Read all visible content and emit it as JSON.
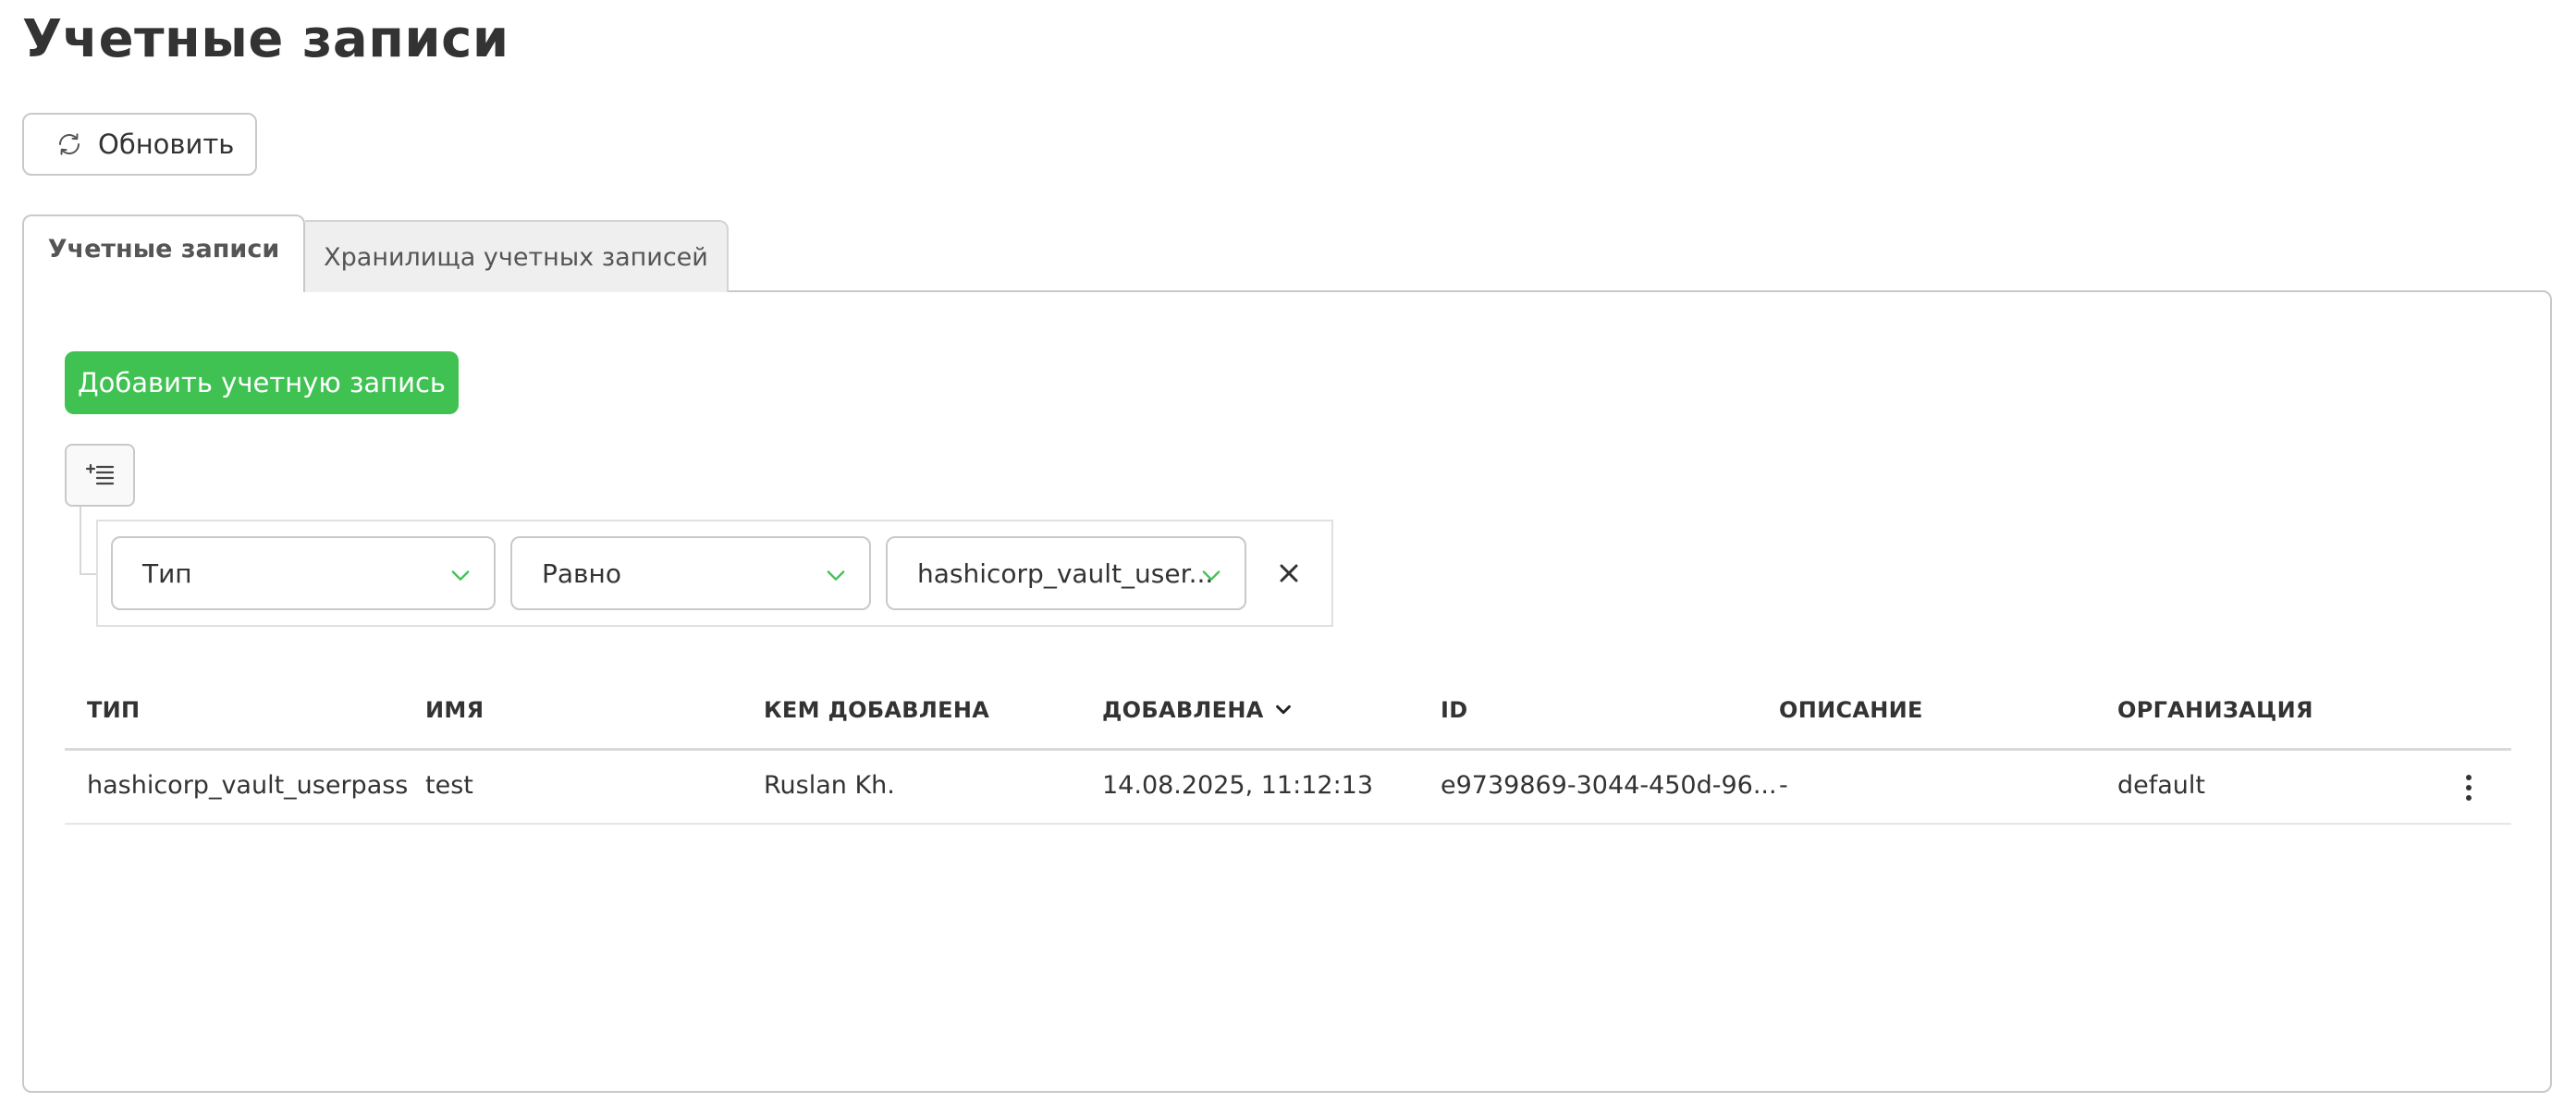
{
  "page": {
    "title": "Учетные записи"
  },
  "toolbar": {
    "refresh_label": "Обновить"
  },
  "tabs": [
    {
      "label": "Учетные записи",
      "active": true
    },
    {
      "label": "Хранилища учетных записей",
      "active": false
    }
  ],
  "actions": {
    "add_label": "Добавить учетную запись",
    "add_color": "#3fc252"
  },
  "filter": {
    "field": "Тип",
    "operator": "Равно",
    "value": "hashicorp_vault_user..."
  },
  "table": {
    "columns": [
      "ТИП",
      "ИМЯ",
      "КЕМ ДОБАВЛЕНА",
      "ДОБАВЛЕНА",
      "ID",
      "ОПИСАНИЕ",
      "ОРГАНИЗАЦИЯ"
    ],
    "sorted_column": "ДОБАВЛЕНА",
    "sort_direction": "desc",
    "rows": [
      [
        "hashicorp_vault_userpass",
        "test",
        "Ruslan Kh.",
        "14.08.2025, 11:12:13",
        "e9739869-3044-450d-96...",
        "-",
        "default"
      ]
    ]
  },
  "icons": {
    "refresh": "refresh-icon",
    "filter_toggle": "add-filter-icon",
    "chevron": "chevron-down-icon",
    "remove": "close-icon",
    "sort": "sort-desc-icon",
    "row_menu": "more-vertical-icon"
  },
  "colors": {
    "accent_green": "#3fc252",
    "text": "#333333",
    "border": "#c9c9c9"
  }
}
